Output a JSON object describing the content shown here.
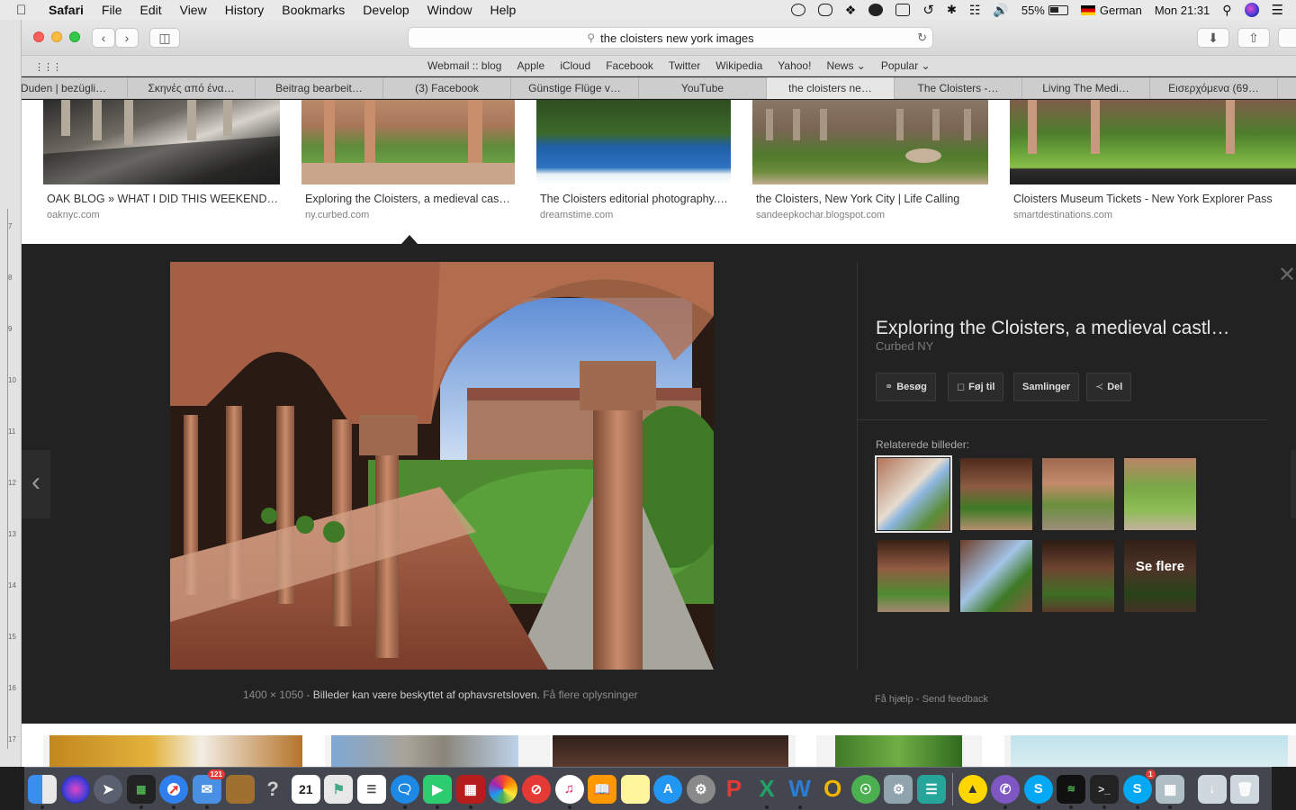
{
  "menubar": {
    "app": "Safari",
    "items": [
      "File",
      "Edit",
      "View",
      "History",
      "Bookmarks",
      "Develop",
      "Window",
      "Help"
    ],
    "battery": "55%",
    "input_lang": "German",
    "clock": "Mon 21:31"
  },
  "browser": {
    "url_text": "the cloisters new york  images",
    "favorites": [
      "Webmail :: blog",
      "Apple",
      "iCloud",
      "Facebook",
      "Twitter",
      "Wikipedia",
      "Yahoo!",
      "News ⌄",
      "Popular ⌄"
    ],
    "tabs": [
      {
        "label": "Duden | bezügli…",
        "active": false
      },
      {
        "label": "Σκηνές από ένα…",
        "active": false
      },
      {
        "label": "Beitrag bearbeit…",
        "active": false
      },
      {
        "label": "(3) Facebook",
        "active": false
      },
      {
        "label": "Günstige Flüge v…",
        "active": false
      },
      {
        "label": "YouTube",
        "active": false
      },
      {
        "label": "the cloisters ne…",
        "active": true
      },
      {
        "label": "The Cloisters -…",
        "active": false
      },
      {
        "label": "Living The Medi…",
        "active": false
      },
      {
        "label": "Εισερχόμενα (69…",
        "active": false
      }
    ],
    "sidebar_ticks": [
      "7",
      "8",
      "9",
      "10",
      "11",
      "12",
      "13",
      "14",
      "15",
      "16",
      "17"
    ]
  },
  "results": [
    {
      "title": "OAK BLOG » WHAT I DID THIS WEEKEND…",
      "source": "oaknyc.com"
    },
    {
      "title": "Exploring the Cloisters, a medieval cas…",
      "source": "ny.curbed.com"
    },
    {
      "title": "The Cloisters editorial photography.…",
      "source": "dreamstime.com"
    },
    {
      "title": "the Cloisters, New York City | Life Calling",
      "source": "sandeepkochar.blogspot.com"
    },
    {
      "title": "Cloisters Museum Tickets - New York Explorer Pass",
      "source": "smartdestinations.com"
    }
  ],
  "viewer": {
    "title": "Exploring the Cloisters, a medieval castl…",
    "source": "Curbed NY",
    "actions": [
      {
        "label": "Besøg",
        "icon": "globe-icon"
      },
      {
        "label": "Føj til",
        "icon": "bookmark-icon"
      },
      {
        "label": "Samlinger",
        "icon": ""
      },
      {
        "label": "Del",
        "icon": "share-icon"
      }
    ],
    "related_label": "Relaterede billeder:",
    "see_more": "Se flere",
    "dimensions": "1400 × 1050",
    "separator": " - ",
    "copyright": "Billeder kan være beskyttet af ophavsretsloven.",
    "more_info": "Få flere oplysninger",
    "help": "Få hjælp",
    "feedback": "Send feedback"
  },
  "dock": {
    "badges": {
      "mail": "121",
      "calendar_day": "21",
      "skype": "1"
    }
  },
  "colors": {
    "panel_bg": "#222222",
    "page_bg": "#ffffff",
    "menubar_bg": "#e9e9e9"
  }
}
